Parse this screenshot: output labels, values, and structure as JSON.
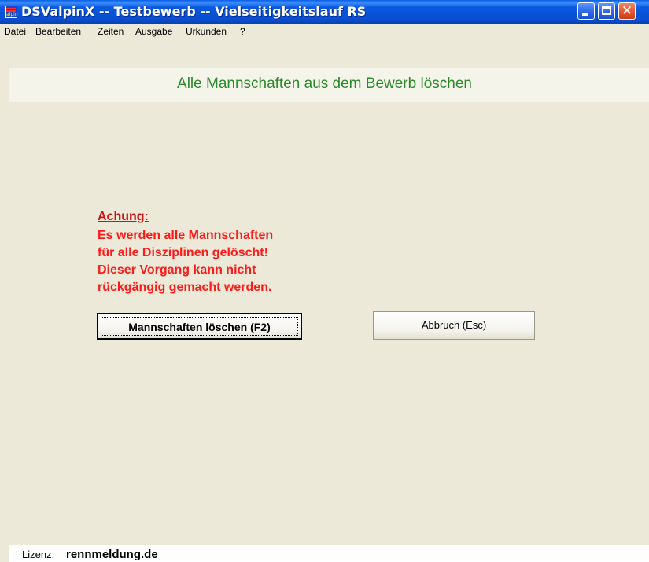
{
  "window": {
    "title": "DSValpinX -- Testbewerb -- Vielseitigkeitslauf RS",
    "icon": "app-logo-icon",
    "icon_text": "alpin",
    "title_bar_color": "#0553d6"
  },
  "menu": {
    "items": [
      "Datei",
      "Bearbeiten",
      "Zeiten",
      "Ausgabe",
      "Urkunden",
      "?"
    ]
  },
  "header": {
    "title": "Alle Mannschaften aus dem Bewerb löschen",
    "title_color": "#2a8a2a"
  },
  "warning": {
    "heading": "Achung:",
    "lines": [
      "Es werden alle Mannschaften",
      "für alle Disziplinen gelöscht!",
      "Dieser Vorgang kann nicht",
      "rückgängig gemacht werden."
    ],
    "color": "#ff1a1a"
  },
  "buttons": {
    "delete_label": "Mannschaften löschen (F2)",
    "cancel_label": "Abbruch (Esc)"
  },
  "status": {
    "label": "Lizenz:",
    "value": "rennmeldung.de"
  }
}
